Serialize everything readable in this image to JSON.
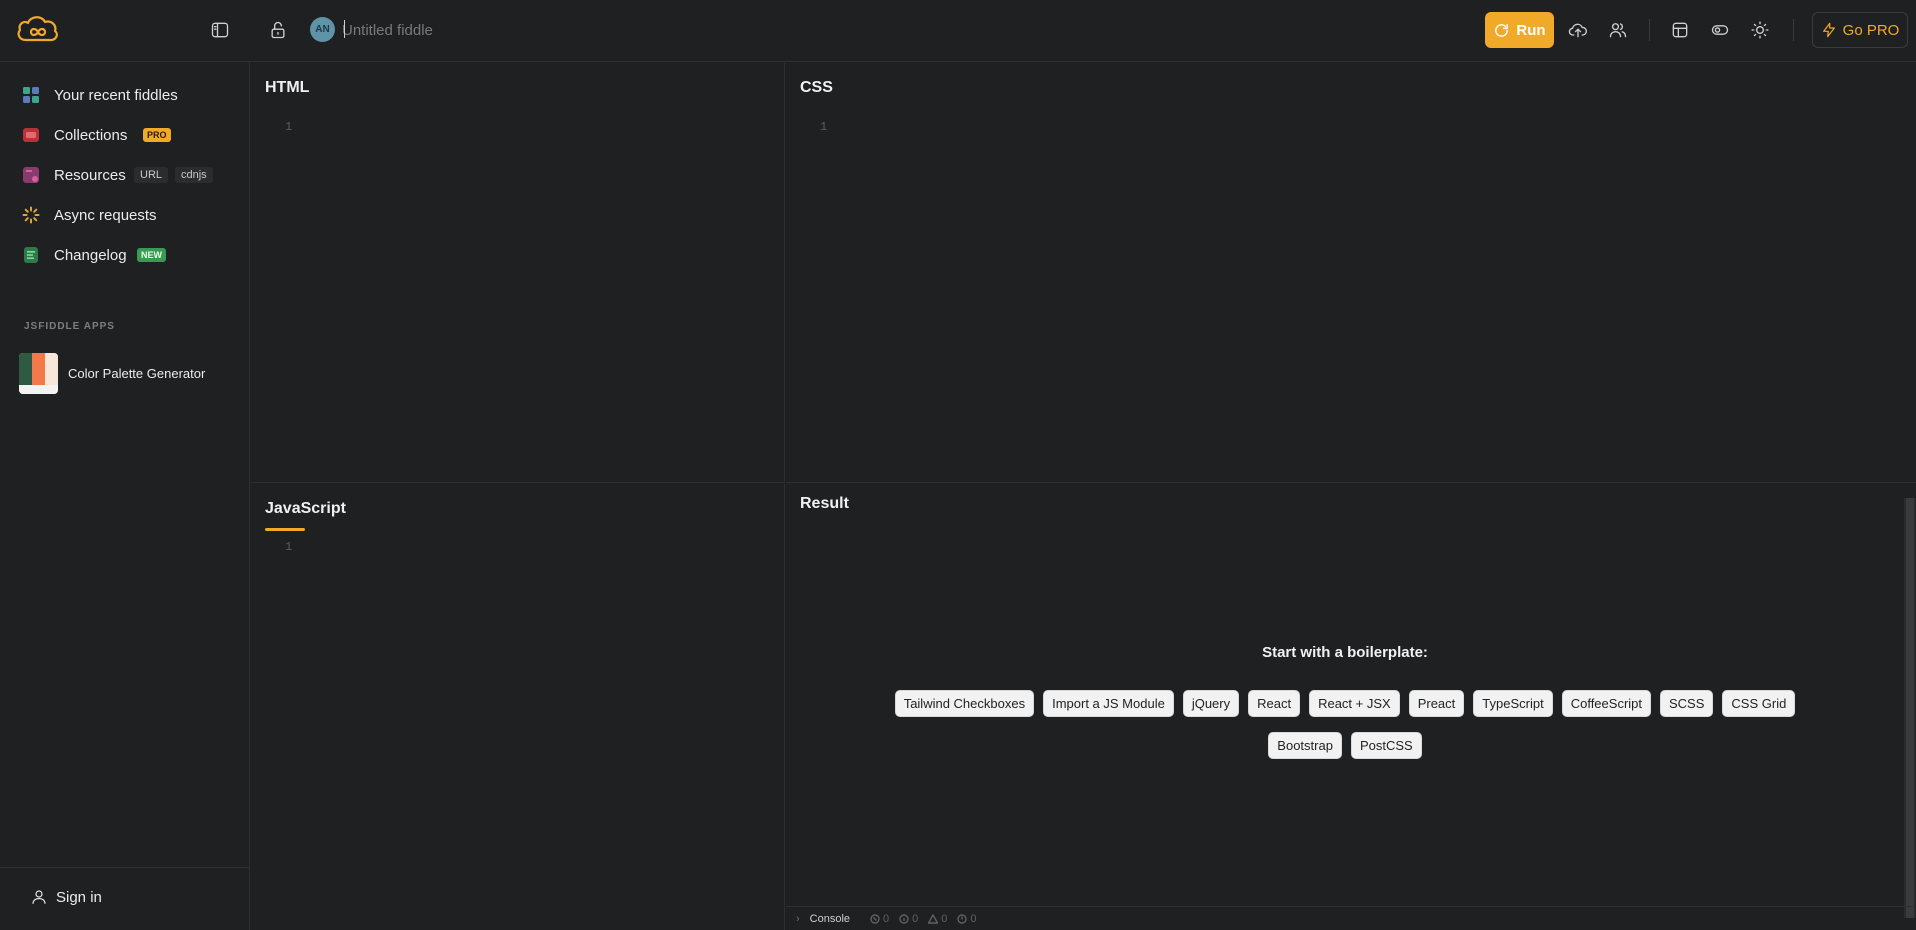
{
  "header": {
    "title_placeholder": "Untitled fiddle",
    "avatar_initials": "AN",
    "run_label": "Run",
    "gopro_label": "Go PRO",
    "accent_color": "#f0a928"
  },
  "sidebar": {
    "items": [
      {
        "label": "Your recent fiddles",
        "icon": "grid-icon"
      },
      {
        "label": "Collections",
        "icon": "archive-icon",
        "badge": "PRO"
      },
      {
        "label": "Resources",
        "icon": "resources-icon",
        "chips": [
          "URL",
          "cdnjs"
        ]
      },
      {
        "label": "Async requests",
        "icon": "async-icon"
      },
      {
        "label": "Changelog",
        "icon": "changelog-icon",
        "badge": "NEW"
      }
    ],
    "apps_heading": "JSFIDDLE APPS",
    "apps": [
      {
        "label": "Color Palette Generator"
      }
    ],
    "signin_label": "Sign in"
  },
  "panels": {
    "html_title": "HTML",
    "css_title": "CSS",
    "js_title": "JavaScript",
    "result_title": "Result",
    "line_number": "1"
  },
  "result": {
    "boilerplate_heading": "Start with a boilerplate:",
    "boilerplates_row1": [
      "Tailwind Checkboxes",
      "Import a JS Module",
      "jQuery",
      "React",
      "React + JSX",
      "Preact",
      "TypeScript",
      "CoffeeScript",
      "SCSS",
      "CSS Grid"
    ],
    "boilerplates_row2": [
      "Bootstrap",
      "PostCSS"
    ]
  },
  "console": {
    "label": "Console",
    "counts": [
      "0",
      "0",
      "0",
      "0"
    ]
  }
}
